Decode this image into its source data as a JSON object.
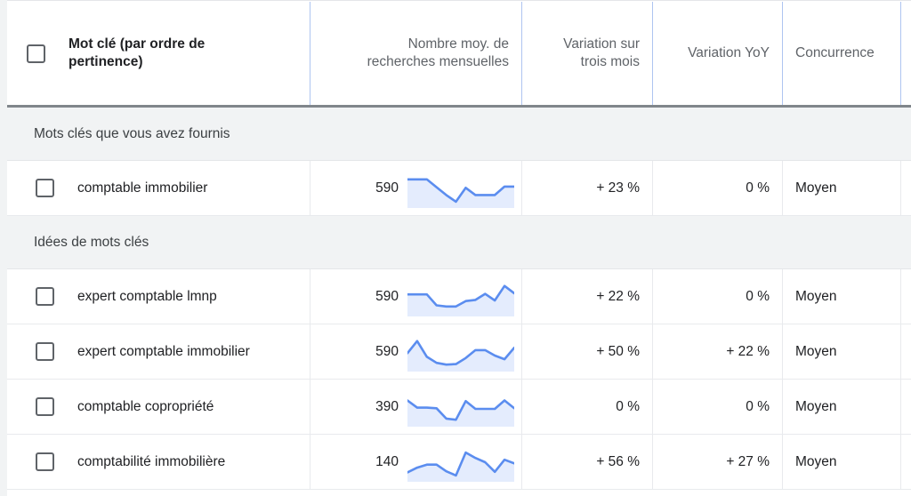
{
  "table": {
    "columns": [
      {
        "key": "keyword",
        "label": "Mot clé (par ordre de pertinence)",
        "align": "left"
      },
      {
        "key": "volume",
        "label": "Nombre moy. de recherches mensuelles",
        "align": "right"
      },
      {
        "key": "change_3m",
        "label": "Variation sur trois mois",
        "align": "right"
      },
      {
        "key": "change_yoy",
        "label": "Variation YoY",
        "align": "right"
      },
      {
        "key": "competition",
        "label": "Concurrence",
        "align": "left"
      }
    ],
    "header": {
      "keyword_line1": "Mot clé (par ordre de",
      "keyword_line2": "pertinence)",
      "volume_line1": "Nombre moy. de",
      "volume_line2": "recherches mensuelles",
      "change_3m_line1": "Variation sur",
      "change_3m_line2": "trois mois",
      "change_yoy": "Variation YoY",
      "competition": "Concurrence",
      "select_all_checkbox": "select-all"
    },
    "groups": [
      {
        "title": "Mots clés que vous avez fournis",
        "rows": [
          {
            "keyword": "comptable immobilier",
            "volume": "590",
            "change_3m": "+ 23 %",
            "change_yoy": "0 %",
            "competition": "Moyen",
            "sparkline": [
              86,
              86,
              86,
              60,
              34,
              12,
              58,
              34,
              34,
              34,
              62,
              62
            ]
          }
        ]
      },
      {
        "title": "Idées de mots clés",
        "rows": [
          {
            "keyword": "expert comptable lmnp",
            "volume": "590",
            "change_3m": "+ 22 %",
            "change_yoy": "0 %",
            "competition": "Moyen",
            "sparkline": [
              64,
              64,
              64,
              28,
              24,
              24,
              42,
              46,
              66,
              44,
              92,
              68
            ]
          },
          {
            "keyword": "expert comptable immobilier",
            "volume": "590",
            "change_3m": "+ 50 %",
            "change_yoy": "+ 22 %",
            "competition": "Moyen",
            "sparkline": [
              52,
              92,
              40,
              20,
              14,
              16,
              36,
              62,
              62,
              44,
              32,
              70
            ]
          },
          {
            "keyword": "comptable copropriété",
            "volume": "390",
            "change_3m": "0 %",
            "change_yoy": "0 %",
            "competition": "Moyen",
            "sparkline": [
              78,
              54,
              54,
              52,
              18,
              14,
              76,
              50,
              50,
              50,
              78,
              52
            ]
          },
          {
            "keyword": "comptabilité immobilière",
            "volume": "140",
            "change_3m": "+ 56 %",
            "change_yoy": "+ 27 %",
            "competition": "Moyen",
            "sparkline": [
              22,
              38,
              48,
              48,
              26,
              12,
              88,
              70,
              56,
              24,
              64,
              52
            ]
          }
        ]
      }
    ],
    "colors": {
      "spark_line": "#5b8def",
      "spark_fill": "#e4ecfd",
      "group_bg": "#f1f3f4",
      "header_rule": "#80868b",
      "header_divider": "#aec4f0"
    }
  }
}
